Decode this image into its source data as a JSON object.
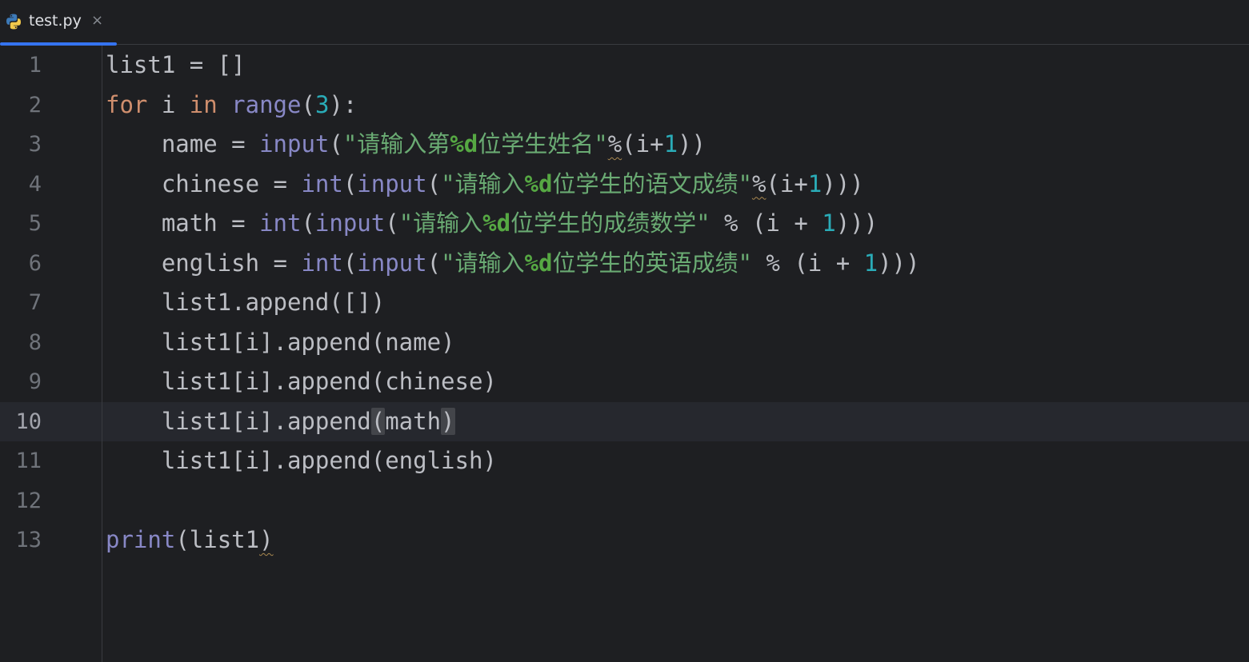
{
  "tab": {
    "title": "test.py",
    "close_label": "×",
    "icon": "python-file-icon"
  },
  "editor": {
    "current_line": 10,
    "colors": {
      "keyword": "#cf8e6d",
      "builtin": "#8888c6",
      "number": "#2aacb8",
      "string": "#6aab73",
      "text": "#bcbec4",
      "accent": "#3574f0"
    },
    "lines": [
      {
        "n": "1",
        "tokens": [
          [
            "t",
            "list1 = []"
          ]
        ]
      },
      {
        "n": "2",
        "tokens": [
          [
            "kw",
            "for"
          ],
          [
            "t",
            " i "
          ],
          [
            "kw",
            "in"
          ],
          [
            "t",
            " "
          ],
          [
            "bi",
            "range"
          ],
          [
            "t",
            "("
          ],
          [
            "num",
            "3"
          ],
          [
            "t",
            "):"
          ]
        ]
      },
      {
        "n": "3",
        "tokens": [
          [
            "t",
            "    name = "
          ],
          [
            "bi",
            "input"
          ],
          [
            "t",
            "("
          ],
          [
            "str",
            "\"请输入第"
          ],
          [
            "fmt",
            "%d"
          ],
          [
            "str",
            "位学生姓名\""
          ],
          [
            "sq",
            "%"
          ],
          [
            "t",
            "(i+"
          ],
          [
            "num",
            "1"
          ],
          [
            "t",
            "))"
          ]
        ]
      },
      {
        "n": "4",
        "tokens": [
          [
            "t",
            "    chinese = "
          ],
          [
            "bi",
            "int"
          ],
          [
            "t",
            "("
          ],
          [
            "bi",
            "input"
          ],
          [
            "t",
            "("
          ],
          [
            "str",
            "\"请输入"
          ],
          [
            "fmt",
            "%d"
          ],
          [
            "str",
            "位学生的语文成绩\""
          ],
          [
            "sq",
            "%"
          ],
          [
            "t",
            "(i+"
          ],
          [
            "num",
            "1"
          ],
          [
            "t",
            ")))"
          ]
        ]
      },
      {
        "n": "5",
        "tokens": [
          [
            "t",
            "    math = "
          ],
          [
            "bi",
            "int"
          ],
          [
            "t",
            "("
          ],
          [
            "bi",
            "input"
          ],
          [
            "t",
            "("
          ],
          [
            "str",
            "\"请输入"
          ],
          [
            "fmt",
            "%d"
          ],
          [
            "str",
            "位学生的成绩数学\""
          ],
          [
            "t",
            " % (i + "
          ],
          [
            "num",
            "1"
          ],
          [
            "t",
            ")))"
          ]
        ]
      },
      {
        "n": "6",
        "tokens": [
          [
            "t",
            "    english = "
          ],
          [
            "bi",
            "int"
          ],
          [
            "t",
            "("
          ],
          [
            "bi",
            "input"
          ],
          [
            "t",
            "("
          ],
          [
            "str",
            "\"请输入"
          ],
          [
            "fmt",
            "%d"
          ],
          [
            "str",
            "位学生的英语成绩\""
          ],
          [
            "t",
            " % (i + "
          ],
          [
            "num",
            "1"
          ],
          [
            "t",
            ")))"
          ]
        ]
      },
      {
        "n": "7",
        "tokens": [
          [
            "t",
            "    list1.append([])"
          ]
        ]
      },
      {
        "n": "8",
        "tokens": [
          [
            "t",
            "    list1[i].append(name)"
          ]
        ]
      },
      {
        "n": "9",
        "tokens": [
          [
            "t",
            "    list1[i].append(chinese)"
          ]
        ]
      },
      {
        "n": "10",
        "tokens": [
          [
            "t",
            "    list1[i].append"
          ],
          [
            "br",
            "("
          ],
          [
            "t",
            "math"
          ],
          [
            "br",
            ")"
          ]
        ]
      },
      {
        "n": "11",
        "tokens": [
          [
            "t",
            "    list1[i].append(english)"
          ]
        ]
      },
      {
        "n": "12",
        "tokens": []
      },
      {
        "n": "13",
        "tokens": [
          [
            "bi",
            "print"
          ],
          [
            "t",
            "(list1"
          ],
          [
            "sq",
            ")"
          ]
        ]
      }
    ]
  }
}
